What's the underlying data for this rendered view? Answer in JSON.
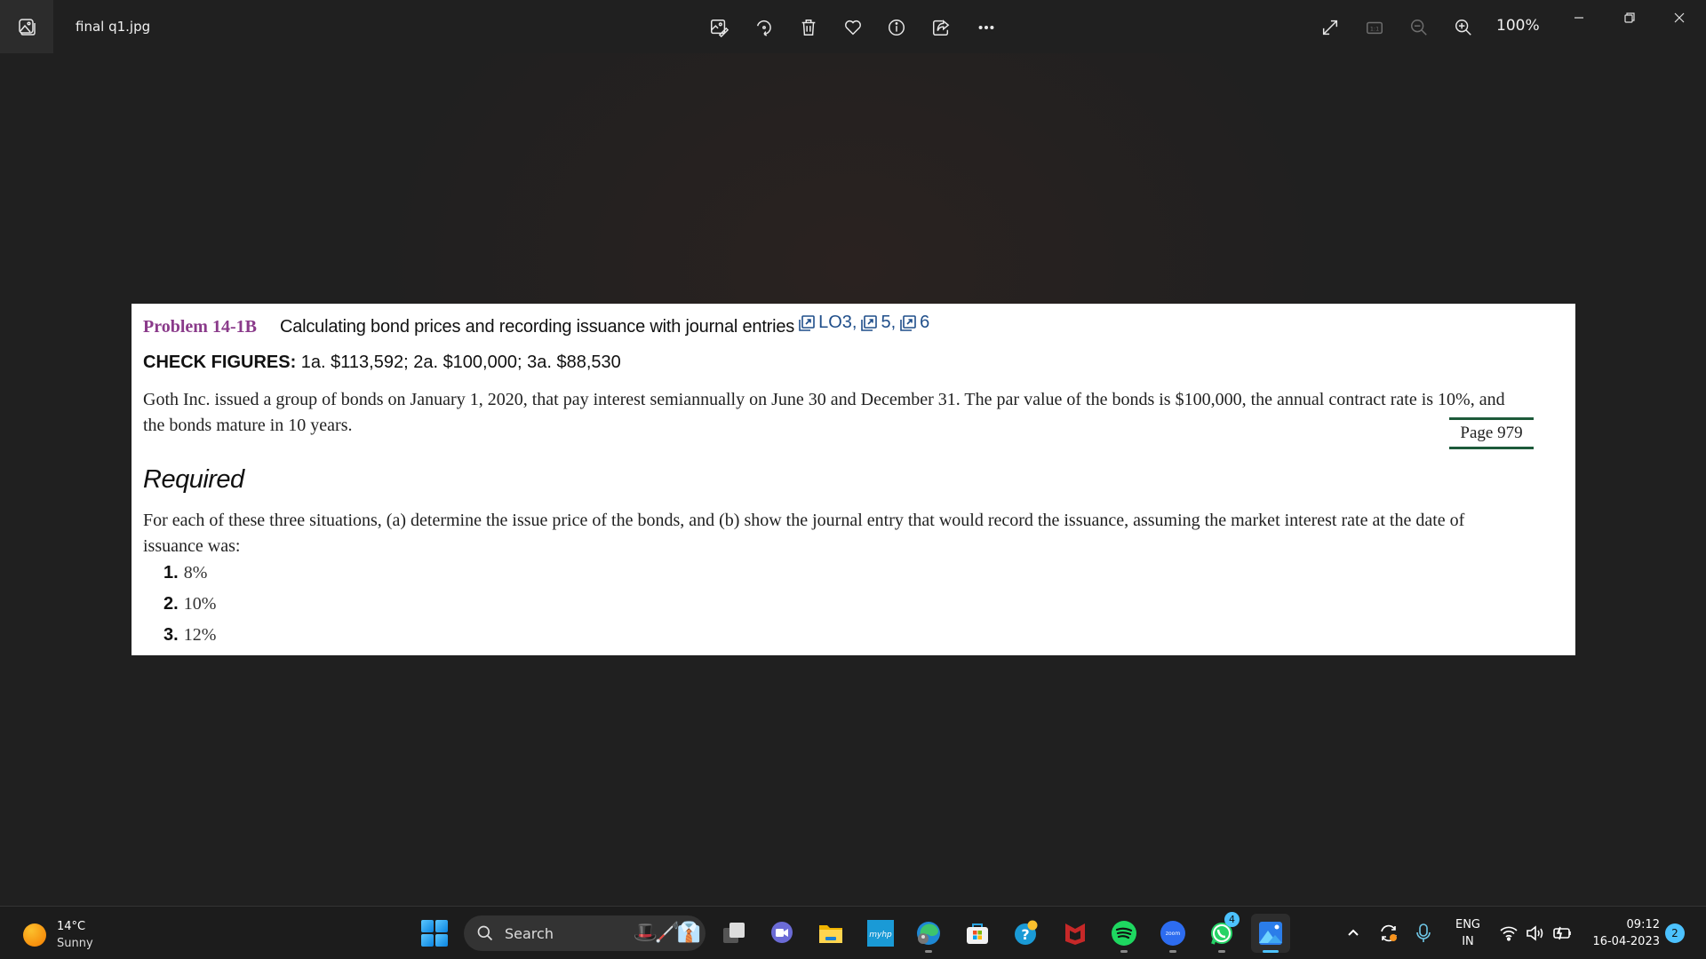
{
  "titlebar": {
    "file_name": "final q1.jpg",
    "zoom_level": "100%",
    "toolbar_icons": [
      "edit-image-icon",
      "rotate-icon",
      "delete-icon",
      "favorite-icon",
      "info-icon",
      "share-icon",
      "more-icon"
    ],
    "right_icons": [
      "fullscreen-icon",
      "actual-size-icon",
      "zoom-out-icon",
      "zoom-in-icon"
    ],
    "window_controls": [
      "minimize",
      "restore",
      "close"
    ]
  },
  "document": {
    "problem_number": "Problem 14-1B",
    "problem_title": "Calculating bond prices and recording issuance with journal entries",
    "lo_links": [
      "LO3,",
      "5,",
      "6"
    ],
    "check_label": "CHECK FIGURES:",
    "check_values": "1a. $113,592; 2a. $100,000; 3a. $88,530",
    "paragraph1": "Goth Inc. issued a group of bonds on January 1, 2020, that pay interest semiannually on June 30 and December 31. The par value of the bonds is $100,000, the annual contract rate is 10%, and the bonds mature in 10 years.",
    "page_marker": "Page 979",
    "required_heading": "Required",
    "paragraph2": "For each of these three situations, (a) determine the issue price of the bonds, and (b) show the journal entry that would record the issuance, assuming the market interest rate at the date of issuance was:",
    "situations": [
      {
        "num": "1.",
        "rate": "8%"
      },
      {
        "num": "2.",
        "rate": "10%"
      },
      {
        "num": "3.",
        "rate": "12%"
      }
    ]
  },
  "taskbar": {
    "weather": {
      "temp": "14°C",
      "condition": "Sunny"
    },
    "search_label": "Search",
    "apps": [
      {
        "name": "task-view",
        "running": false
      },
      {
        "name": "teams-chat",
        "running": false
      },
      {
        "name": "file-explorer",
        "running": false
      },
      {
        "name": "myhp",
        "label": "myhp",
        "running": false
      },
      {
        "name": "edge",
        "running": true
      },
      {
        "name": "microsoft-store",
        "running": false
      },
      {
        "name": "get-help",
        "running": false
      },
      {
        "name": "mcafee",
        "running": false
      },
      {
        "name": "spotify",
        "running": true
      },
      {
        "name": "zoom",
        "label": "zoom",
        "running": true
      },
      {
        "name": "whatsapp",
        "running": true,
        "badge": "4"
      },
      {
        "name": "photos",
        "running": true,
        "active": true
      }
    ],
    "language": {
      "line1": "ENG",
      "line2": "IN"
    },
    "time": "09:12",
    "date": "16-04-2023",
    "notification_count": "2"
  }
}
